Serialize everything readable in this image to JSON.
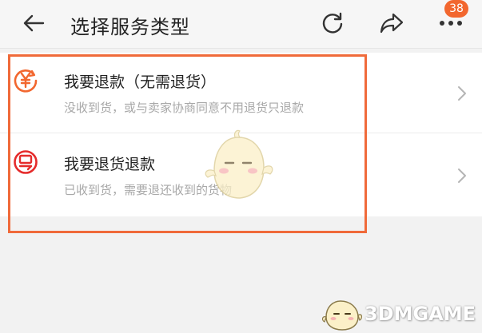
{
  "header": {
    "title": "选择服务类型",
    "badge_count": "38",
    "back_icon": "arrow-left-icon",
    "refresh_icon": "refresh-icon",
    "share_icon": "share-icon",
    "more_icon": "more-dots-icon"
  },
  "options": [
    {
      "title": "我要退款（无需退货）",
      "subtitle": "没收到货，或与卖家协商同意不用退货只退款",
      "icon": "yuan-refund-icon",
      "icon_color": "#f2672f"
    },
    {
      "title": "我要退货退款",
      "subtitle": "已收到货，需要退还收到的货物",
      "icon": "return-goods-icon",
      "icon_color": "#e52b2b"
    }
  ],
  "annotation": {
    "highlight_color": "#f06a3a"
  },
  "watermark": {
    "brand": "3DMGAME"
  }
}
